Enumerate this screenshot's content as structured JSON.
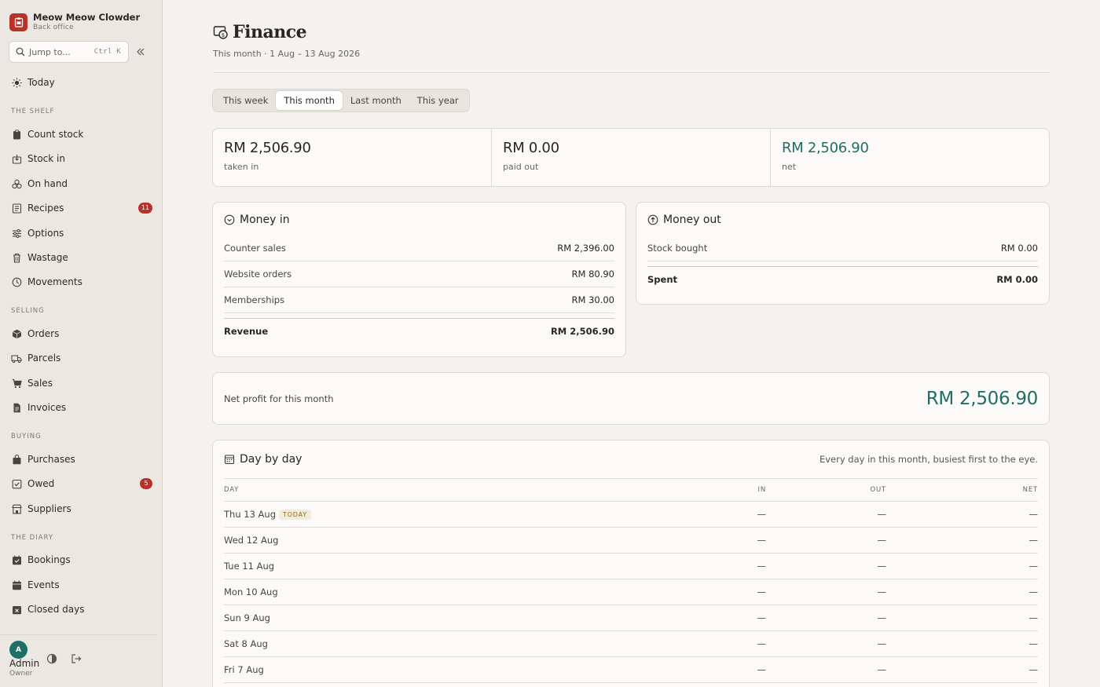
{
  "brand": {
    "name": "Meow Meow Clowder",
    "subtitle": "Back office",
    "color": "#b8322a"
  },
  "search": {
    "placeholder": "Jump to...",
    "shortcut": "Ctrl K"
  },
  "nav": {
    "today": {
      "label": "Today",
      "icon": "sun-icon"
    },
    "sections": [
      {
        "heading": "THE SHELF",
        "items": [
          {
            "label": "Count stock",
            "icon": "clipboard-icon"
          },
          {
            "label": "Stock in",
            "icon": "box-in-icon"
          },
          {
            "label": "On hand",
            "icon": "boxes-icon"
          },
          {
            "label": "Recipes",
            "icon": "list-icon",
            "badge": "11"
          },
          {
            "label": "Options",
            "icon": "sliders-icon"
          },
          {
            "label": "Wastage",
            "icon": "trash-icon"
          },
          {
            "label": "Movements",
            "icon": "history-icon"
          }
        ]
      },
      {
        "heading": "SELLING",
        "items": [
          {
            "label": "Orders",
            "icon": "package-icon"
          },
          {
            "label": "Parcels",
            "icon": "truck-icon"
          },
          {
            "label": "Sales",
            "icon": "cart-icon"
          },
          {
            "label": "Invoices",
            "icon": "document-icon"
          }
        ]
      },
      {
        "heading": "BUYING",
        "items": [
          {
            "label": "Purchases",
            "icon": "bag-icon"
          },
          {
            "label": "Owed",
            "icon": "check-square-icon",
            "badge": "5"
          },
          {
            "label": "Suppliers",
            "icon": "store-icon"
          }
        ]
      },
      {
        "heading": "THE DIARY",
        "items": [
          {
            "label": "Bookings",
            "icon": "calendar-check-icon"
          },
          {
            "label": "Events",
            "icon": "calendar-icon"
          },
          {
            "label": "Closed days",
            "icon": "calendar-x-icon"
          }
        ]
      }
    ]
  },
  "user": {
    "initial": "A",
    "name": "Admin",
    "role": "Owner",
    "avatar_color": "#1f6f67"
  },
  "page": {
    "title": "Finance",
    "subtitle": "This month · 1 Aug – 13 Aug 2026"
  },
  "tabs": [
    {
      "label": "This week",
      "active": false
    },
    {
      "label": "This month",
      "active": true
    },
    {
      "label": "Last month",
      "active": false
    },
    {
      "label": "This year",
      "active": false
    }
  ],
  "stats": [
    {
      "value": "RM 2,506.90",
      "label": "taken in"
    },
    {
      "value": "RM 0.00",
      "label": "paid out"
    },
    {
      "value": "RM 2,506.90",
      "label": "net",
      "accent": "#1f6f67"
    }
  ],
  "money_in": {
    "title": "Money in",
    "rows": [
      {
        "label": "Counter sales",
        "amount": "RM 2,396.00"
      },
      {
        "label": "Website orders",
        "amount": "RM 80.90"
      },
      {
        "label": "Memberships",
        "amount": "RM 30.00"
      }
    ],
    "total": {
      "label": "Revenue",
      "amount": "RM 2,506.90"
    }
  },
  "money_out": {
    "title": "Money out",
    "rows": [
      {
        "label": "Stock bought",
        "amount": "RM 0.00"
      }
    ],
    "total": {
      "label": "Spent",
      "amount": "RM 0.00"
    }
  },
  "net_profit": {
    "label": "Net profit for this month",
    "value": "RM 2,506.90"
  },
  "day_by_day": {
    "title": "Day by day",
    "description": "Every day in this month, busiest first to the eye.",
    "columns": [
      "DAY",
      "IN",
      "OUT",
      "NET"
    ],
    "today_tag": "TODAY",
    "rows": [
      {
        "day": "Thu 13 Aug",
        "today": true,
        "in": "—",
        "out": "—",
        "net": "—"
      },
      {
        "day": "Wed 12 Aug",
        "in": "—",
        "out": "—",
        "net": "—"
      },
      {
        "day": "Tue 11 Aug",
        "in": "—",
        "out": "—",
        "net": "—"
      },
      {
        "day": "Mon 10 Aug",
        "in": "—",
        "out": "—",
        "net": "—"
      },
      {
        "day": "Sun 9 Aug",
        "in": "—",
        "out": "—",
        "net": "—"
      },
      {
        "day": "Sat 8 Aug",
        "in": "—",
        "out": "—",
        "net": "—"
      },
      {
        "day": "Fri 7 Aug",
        "in": "—",
        "out": "—",
        "net": "—"
      }
    ]
  }
}
